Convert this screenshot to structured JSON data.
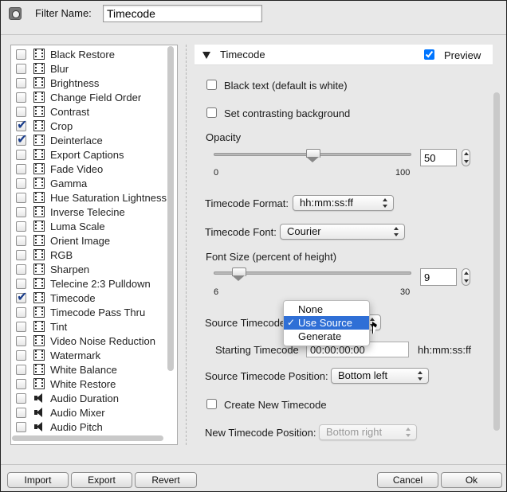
{
  "header": {
    "filter_name_label": "Filter Name:",
    "filter_name_value": "Timecode"
  },
  "filters": [
    {
      "label": "Black Restore",
      "checked": false,
      "icon": "film-icon"
    },
    {
      "label": "Blur",
      "checked": false,
      "icon": "film-icon"
    },
    {
      "label": "Brightness",
      "checked": false,
      "icon": "film-icon"
    },
    {
      "label": "Change Field Order",
      "checked": false,
      "icon": "film-icon"
    },
    {
      "label": "Contrast",
      "checked": false,
      "icon": "film-icon"
    },
    {
      "label": "Crop",
      "checked": true,
      "icon": "film-icon"
    },
    {
      "label": "Deinterlace",
      "checked": true,
      "icon": "film-icon"
    },
    {
      "label": "Export Captions",
      "checked": false,
      "icon": "film-icon"
    },
    {
      "label": "Fade Video",
      "checked": false,
      "icon": "film-icon"
    },
    {
      "label": "Gamma",
      "checked": false,
      "icon": "film-icon"
    },
    {
      "label": "Hue Saturation Lightness",
      "checked": false,
      "icon": "film-icon"
    },
    {
      "label": "Inverse Telecine",
      "checked": false,
      "icon": "film-icon"
    },
    {
      "label": "Luma Scale",
      "checked": false,
      "icon": "film-icon"
    },
    {
      "label": "Orient Image",
      "checked": false,
      "icon": "film-icon"
    },
    {
      "label": "RGB",
      "checked": false,
      "icon": "film-icon"
    },
    {
      "label": "Sharpen",
      "checked": false,
      "icon": "film-icon"
    },
    {
      "label": "Telecine 2:3 Pulldown",
      "checked": false,
      "icon": "film-icon"
    },
    {
      "label": "Timecode",
      "checked": true,
      "icon": "film-icon"
    },
    {
      "label": "Timecode Pass Thru",
      "checked": false,
      "icon": "film-icon"
    },
    {
      "label": "Tint",
      "checked": false,
      "icon": "film-icon"
    },
    {
      "label": "Video Noise Reduction",
      "checked": false,
      "icon": "film-icon"
    },
    {
      "label": "Watermark",
      "checked": false,
      "icon": "film-icon"
    },
    {
      "label": "White Balance",
      "checked": false,
      "icon": "film-icon"
    },
    {
      "label": "White Restore",
      "checked": false,
      "icon": "film-icon"
    },
    {
      "label": "Audio Duration",
      "checked": false,
      "icon": "speaker-icon"
    },
    {
      "label": "Audio Mixer",
      "checked": false,
      "icon": "speaker-icon"
    },
    {
      "label": "Audio Pitch",
      "checked": false,
      "icon": "speaker-icon"
    }
  ],
  "settings": {
    "title": "Timecode",
    "preview_label": "Preview",
    "preview_checked": true,
    "black_text_label": "Black text (default is white)",
    "contrasting_bg_label": "Set contrasting background",
    "opacity": {
      "label": "Opacity",
      "min": "0",
      "max": "100",
      "value": "50",
      "fraction": 0.5
    },
    "timecode_format": {
      "label": "Timecode Format:",
      "value": "hh:mm:ss:ff"
    },
    "timecode_font": {
      "label": "Timecode Font:",
      "value": "Courier"
    },
    "font_size": {
      "label": "Font Size (percent of height)",
      "min": "6",
      "max": "30",
      "value": "9",
      "fraction": 0.125
    },
    "source_timecode_label": "Source Timecode",
    "starting_timecode": {
      "label": "Starting Timecode",
      "value": "00:00:00:00",
      "format_hint": "hh:mm:ss:ff"
    },
    "source_timecode_position": {
      "label": "Source Timecode Position:",
      "value": "Bottom left"
    },
    "create_new_label": "Create New Timecode",
    "new_timecode_position": {
      "label": "New Timecode Position:",
      "value": "Bottom right"
    }
  },
  "source_menu": {
    "items": [
      "None",
      "Use Source",
      "Generate"
    ],
    "selected": "Use Source",
    "check": "✓"
  },
  "footer": {
    "import_label": "Import",
    "export_label": "Export",
    "revert_label": "Revert",
    "cancel_label": "Cancel",
    "ok_label": "Ok"
  }
}
